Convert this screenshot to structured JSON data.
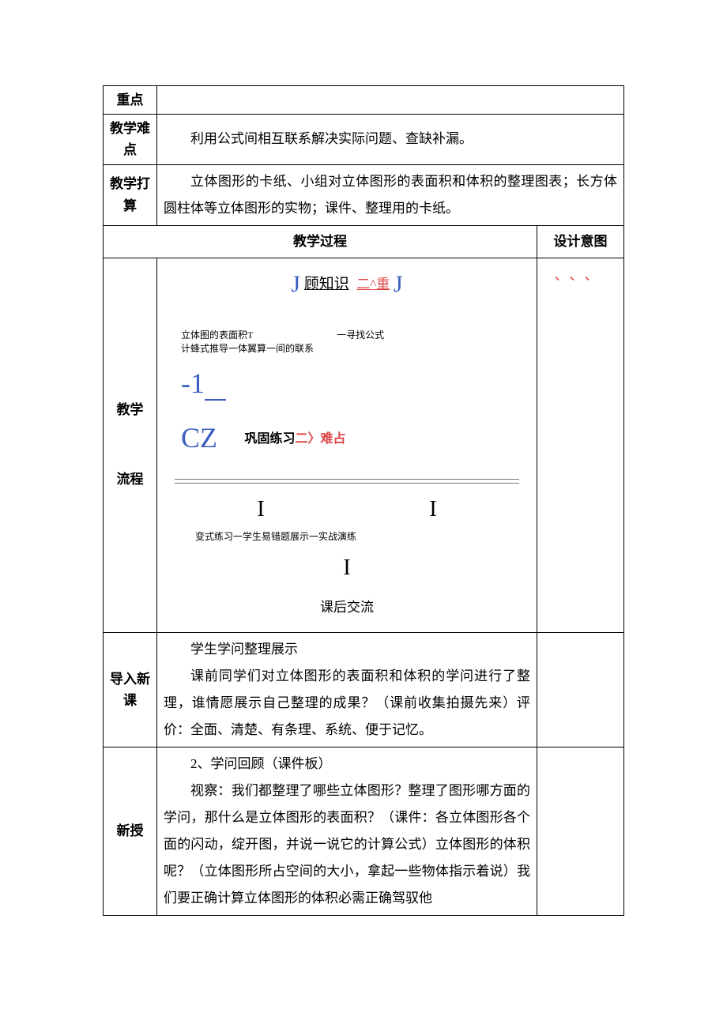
{
  "rows": {
    "r1_label": "重点",
    "r1_content": "",
    "r2_label": "教学难点",
    "r2_content": "利用公式间相互联系解决实际问题、查缺补漏。",
    "r3_label": "教学打算",
    "r3_content": "立体图形的卡纸、小组对立体图形的表面积和体积的整理图表；长方体圆柱体等立体图形的实物；课件、整理用的卡纸。",
    "process_header": "教学过程",
    "design_header": "设计意图",
    "flow_label": "教学\n\n流程",
    "title_letter1": "J",
    "title_mid": "顾知识",
    "title_red": "二^重",
    "title_letter2": "J",
    "small1": "立体图的表面积T",
    "small1b": "一寻找公式",
    "small2": "计蜂式推导一体翼算一间的联系",
    "minus_one": "-1",
    "cz": "CZ",
    "consolidate": "巩固练习",
    "consolidate_red": "二〉难占",
    "variant_line": "变式练习一学生易错题展示一实战演练",
    "after_class": "课后交流",
    "design_marks": "、、、",
    "intro_label": "导入新课",
    "intro_p1": "学生学问整理展示",
    "intro_p2": "课前同学们对立体图形的表面积和体积的学问进行了整理，谁情愿展示自己整理的成果？（课前收集拍摄先来）评价：全面、清楚、有条理、系统、便于记忆。",
    "new_label": "新授",
    "new_p1": "2、学问回顾（课件板）",
    "new_p2": "视察：我们都整理了哪些立体图形？整理了图形哪方面的学问，那什么是立体图形的表面积？（课件：各立体图形各个面的闪动，绽开图，并说一说它的计算公式）立体图形的体积呢？（立体图形所占空间的大小，拿起一些物体指示着说）我们要正确计算立体图形的体积必需正确驾驭他"
  }
}
